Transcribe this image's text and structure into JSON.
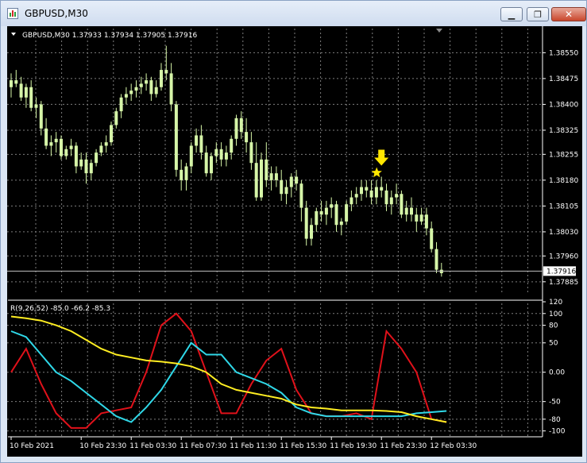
{
  "window": {
    "title": "GBPUSD,M30",
    "minimize_icon": "minimize-icon",
    "restore_icon": "restore-icon",
    "close_icon": "close-icon"
  },
  "colors": {
    "background": "#000000",
    "grid": "#7d7d7d",
    "candle": "#d6f5a8",
    "price_line": "#c0c0c0",
    "signal": "#ffe600",
    "indicator_red": "#e0111a",
    "indicator_cyan": "#2fd8e8",
    "indicator_yellow": "#ffee22"
  },
  "chart_data": [
    {
      "type": "candlestick",
      "header": "GBPUSD,M30  1.37933 1.37934 1.37905 1.37916",
      "symbol": "GBPUSD",
      "timeframe": "M30",
      "ohlc_last": {
        "open": 1.37933,
        "high": 1.37934,
        "low": 1.37905,
        "close": 1.37916
      },
      "current_price": "1.37916",
      "ylim": [
        1.3785,
        1.3862
      ],
      "y_ticks": [
        "1.38550",
        "1.38475",
        "1.38400",
        "1.38325",
        "1.38255",
        "1.38180",
        "1.38105",
        "1.38030",
        "1.37960",
        "1.37885"
      ],
      "y_tick_values": [
        1.3855,
        1.38475,
        1.384,
        1.38325,
        1.38255,
        1.3818,
        1.38105,
        1.3803,
        1.3796,
        1.37885
      ],
      "grid": true,
      "signal_arrow": {
        "icon": "down-arrow-icon",
        "marker": "star-icon",
        "bar": 74,
        "price": 1.3819
      },
      "candles": [
        [
          1.3845,
          1.3849,
          1.3842,
          1.3847
        ],
        [
          1.3847,
          1.385,
          1.3845,
          1.3846
        ],
        [
          1.3846,
          1.3848,
          1.3841,
          1.3842
        ],
        [
          1.3842,
          1.3846,
          1.3839,
          1.3845
        ],
        [
          1.3845,
          1.3847,
          1.3838,
          1.3839
        ],
        [
          1.3839,
          1.3842,
          1.3836,
          1.384
        ],
        [
          1.384,
          1.3841,
          1.3831,
          1.3833
        ],
        [
          1.3833,
          1.3836,
          1.3827,
          1.3828
        ],
        [
          1.3828,
          1.3831,
          1.3825,
          1.3829
        ],
        [
          1.3829,
          1.3832,
          1.3826,
          1.383
        ],
        [
          1.383,
          1.3831,
          1.3824,
          1.3825
        ],
        [
          1.3825,
          1.3828,
          1.3824,
          1.3827
        ],
        [
          1.3827,
          1.383,
          1.3825,
          1.3828
        ],
        [
          1.3828,
          1.3829,
          1.382,
          1.3822
        ],
        [
          1.3822,
          1.3826,
          1.3821,
          1.3824
        ],
        [
          1.3824,
          1.3826,
          1.3817,
          1.382
        ],
        [
          1.382,
          1.3824,
          1.3818,
          1.3823
        ],
        [
          1.3823,
          1.3827,
          1.3822,
          1.3826
        ],
        [
          1.3826,
          1.3829,
          1.3825,
          1.3828
        ],
        [
          1.3828,
          1.3831,
          1.3826,
          1.3829
        ],
        [
          1.3829,
          1.3835,
          1.3828,
          1.3834
        ],
        [
          1.3834,
          1.3839,
          1.3833,
          1.3838
        ],
        [
          1.3838,
          1.3843,
          1.3836,
          1.3842
        ],
        [
          1.3842,
          1.3845,
          1.384,
          1.3843
        ],
        [
          1.3843,
          1.3846,
          1.3841,
          1.3844
        ],
        [
          1.3844,
          1.3847,
          1.3842,
          1.3845
        ],
        [
          1.3845,
          1.3848,
          1.3843,
          1.3846
        ],
        [
          1.3846,
          1.3849,
          1.3844,
          1.3847
        ],
        [
          1.3847,
          1.3848,
          1.3841,
          1.3843
        ],
        [
          1.3843,
          1.3847,
          1.3842,
          1.3845
        ],
        [
          1.3845,
          1.3852,
          1.3844,
          1.385
        ],
        [
          1.385,
          1.3857,
          1.3847,
          1.3849
        ],
        [
          1.3849,
          1.3852,
          1.3838,
          1.384
        ],
        [
          1.384,
          1.3841,
          1.3819,
          1.3821
        ],
        [
          1.3821,
          1.3824,
          1.3815,
          1.3818
        ],
        [
          1.3818,
          1.3823,
          1.3815,
          1.3822
        ],
        [
          1.3822,
          1.3829,
          1.382,
          1.3828
        ],
        [
          1.3828,
          1.3833,
          1.3826,
          1.3831
        ],
        [
          1.3831,
          1.3834,
          1.3824,
          1.3826
        ],
        [
          1.3826,
          1.3828,
          1.3819,
          1.382
        ],
        [
          1.382,
          1.3826,
          1.3818,
          1.3825
        ],
        [
          1.3825,
          1.3829,
          1.3823,
          1.3827
        ],
        [
          1.3827,
          1.3829,
          1.3822,
          1.3824
        ],
        [
          1.3824,
          1.3828,
          1.3822,
          1.3826
        ],
        [
          1.3826,
          1.3831,
          1.3824,
          1.383
        ],
        [
          1.383,
          1.3837,
          1.3828,
          1.3836
        ],
        [
          1.3836,
          1.3838,
          1.383,
          1.3832
        ],
        [
          1.3832,
          1.3836,
          1.3826,
          1.3829
        ],
        [
          1.3829,
          1.3832,
          1.3821,
          1.3823
        ],
        [
          1.3823,
          1.3829,
          1.3812,
          1.3813
        ],
        [
          1.3813,
          1.3826,
          1.3812,
          1.3824
        ],
        [
          1.3824,
          1.3829,
          1.3816,
          1.3818
        ],
        [
          1.3818,
          1.3822,
          1.3815,
          1.382
        ],
        [
          1.382,
          1.3822,
          1.3816,
          1.3818
        ],
        [
          1.3818,
          1.3821,
          1.3812,
          1.3814
        ],
        [
          1.3814,
          1.3818,
          1.3811,
          1.3816
        ],
        [
          1.3816,
          1.382,
          1.3813,
          1.3819
        ],
        [
          1.3819,
          1.3821,
          1.3815,
          1.3817
        ],
        [
          1.3817,
          1.3818,
          1.3806,
          1.381
        ],
        [
          1.381,
          1.3812,
          1.3799,
          1.3801
        ],
        [
          1.3801,
          1.3807,
          1.3799,
          1.3805
        ],
        [
          1.3805,
          1.381,
          1.3803,
          1.3809
        ],
        [
          1.3809,
          1.3812,
          1.3806,
          1.3808
        ],
        [
          1.3808,
          1.3812,
          1.3805,
          1.381
        ],
        [
          1.381,
          1.3813,
          1.3807,
          1.3811
        ],
        [
          1.3811,
          1.3812,
          1.3803,
          1.3805
        ],
        [
          1.3805,
          1.3807,
          1.3802,
          1.3806
        ],
        [
          1.3806,
          1.3812,
          1.3805,
          1.3811
        ],
        [
          1.3811,
          1.3815,
          1.3809,
          1.3813
        ],
        [
          1.3813,
          1.3816,
          1.3811,
          1.3814
        ],
        [
          1.3814,
          1.3818,
          1.3812,
          1.3816
        ],
        [
          1.3816,
          1.3818,
          1.3813,
          1.3815
        ],
        [
          1.3815,
          1.3818,
          1.3811,
          1.3813
        ],
        [
          1.3813,
          1.3818,
          1.3811,
          1.3816
        ],
        [
          1.3816,
          1.3819,
          1.3813,
          1.3815
        ],
        [
          1.3815,
          1.3817,
          1.3809,
          1.3811
        ],
        [
          1.3811,
          1.3815,
          1.3808,
          1.3813
        ],
        [
          1.3813,
          1.3817,
          1.3811,
          1.3814
        ],
        [
          1.3814,
          1.3815,
          1.3807,
          1.3808
        ],
        [
          1.3808,
          1.3812,
          1.3806,
          1.381
        ],
        [
          1.381,
          1.3813,
          1.3806,
          1.3808
        ],
        [
          1.3808,
          1.381,
          1.3803,
          1.3806
        ],
        [
          1.3806,
          1.381,
          1.3805,
          1.3808
        ],
        [
          1.3808,
          1.381,
          1.3802,
          1.3804
        ],
        [
          1.3804,
          1.3806,
          1.3797,
          1.3798
        ],
        [
          1.3798,
          1.38,
          1.3791,
          1.3792
        ],
        [
          1.3792,
          1.3794,
          1.379,
          1.3791
        ]
      ]
    },
    {
      "type": "line",
      "header": "R(9,26,52) -85.0 -66.2 -85.3",
      "indicator": "R(9,26,52)",
      "values_text": [
        "-85.0",
        "-66.2",
        "-85.3"
      ],
      "ylim": [
        -110,
        120
      ],
      "y_ticks": [
        "120",
        "100",
        "80",
        "50",
        "0.00",
        "-50",
        "-80",
        "-100"
      ],
      "y_tick_values": [
        120,
        100,
        80,
        50,
        0,
        -50,
        -80,
        -100
      ],
      "x": [
        0,
        3,
        6,
        9,
        12,
        15,
        18,
        21,
        24,
        27,
        30,
        33,
        36,
        39,
        42,
        45,
        48,
        51,
        54,
        57,
        60,
        63,
        66,
        69,
        72,
        75,
        78,
        81,
        84,
        87
      ],
      "series": [
        {
          "color": "#e0111a",
          "values": [
            0,
            40,
            -20,
            -70,
            -95,
            -95,
            -70,
            -65,
            -60,
            0,
            80,
            100,
            70,
            0,
            -70,
            -70,
            -20,
            20,
            40,
            -30,
            -70,
            -75,
            -75,
            -70,
            -80,
            70,
            40,
            0,
            -80,
            -85
          ]
        },
        {
          "color": "#2fd8e8",
          "values": [
            70,
            60,
            30,
            0,
            -15,
            -35,
            -55,
            -75,
            -85,
            -60,
            -30,
            10,
            50,
            30,
            30,
            0,
            -10,
            -20,
            -35,
            -60,
            -70,
            -75,
            -75,
            -75,
            -75,
            -75,
            -75,
            -70,
            -68,
            -66
          ]
        },
        {
          "color": "#ffee22",
          "values": [
            95,
            92,
            88,
            80,
            70,
            55,
            40,
            30,
            25,
            20,
            18,
            15,
            10,
            0,
            -20,
            -30,
            -35,
            -40,
            -45,
            -55,
            -60,
            -62,
            -65,
            -65,
            -65,
            -66,
            -68,
            -75,
            -80,
            -85
          ]
        }
      ]
    }
  ],
  "x_axis": {
    "labels": [
      {
        "text": "10 Feb 2021",
        "bar": 0
      },
      {
        "text": "10 Feb 23:30",
        "bar": 14
      },
      {
        "text": "11 Feb 03:30",
        "bar": 24
      },
      {
        "text": "11 Feb 07:30",
        "bar": 34
      },
      {
        "text": "11 Feb 11:30",
        "bar": 44
      },
      {
        "text": "11 Feb 15:30",
        "bar": 54
      },
      {
        "text": "11 Feb 19:30",
        "bar": 64
      },
      {
        "text": "11 Feb 23:30",
        "bar": 74
      },
      {
        "text": "12 Feb 03:30",
        "bar": 84
      }
    ]
  }
}
